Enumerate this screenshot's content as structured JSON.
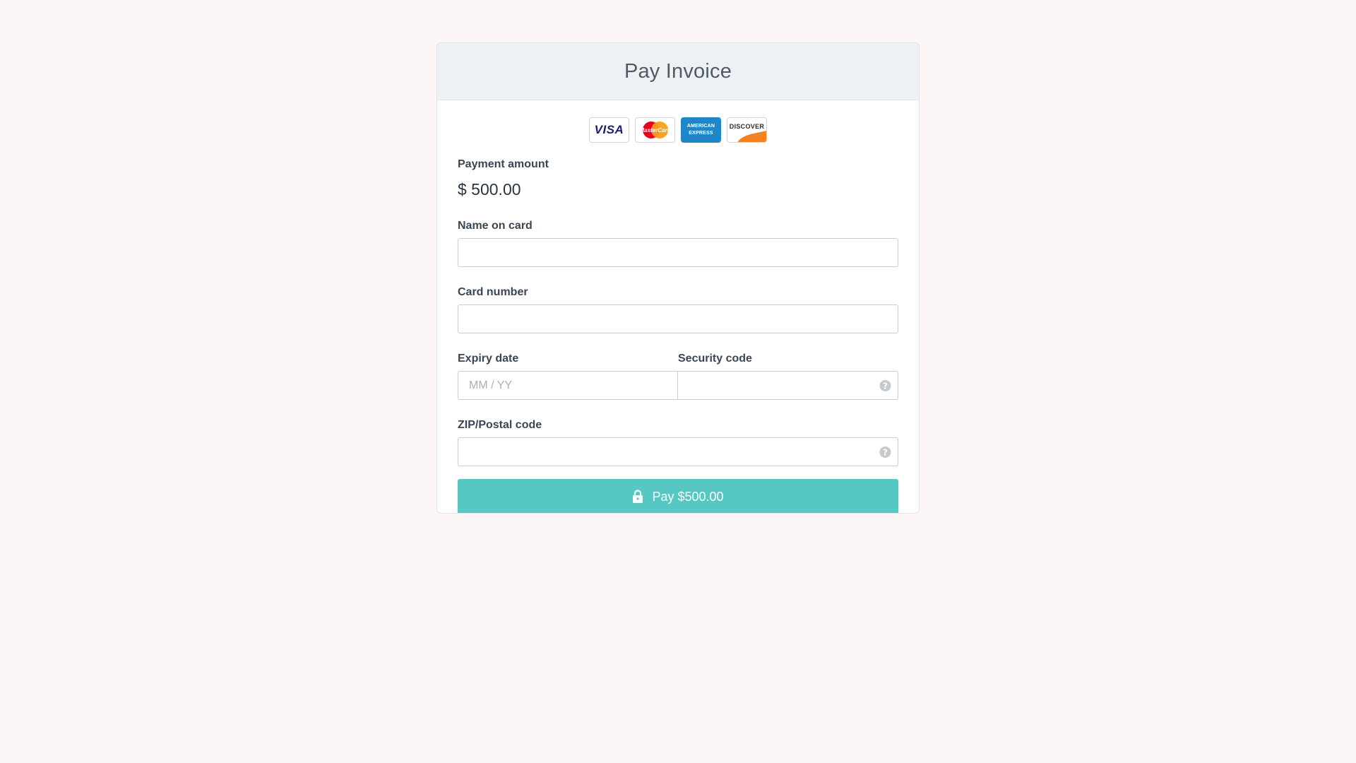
{
  "header": {
    "title": "Pay Invoice"
  },
  "card_brands": [
    {
      "name": "visa",
      "label": "VISA",
      "icon": "visa-logo"
    },
    {
      "name": "mastercard",
      "label": "MasterCard",
      "icon": "mastercard-logo"
    },
    {
      "name": "amex",
      "label_line1": "AMERICAN",
      "label_line2": "EXPRESS",
      "icon": "amex-logo"
    },
    {
      "name": "discover",
      "label": "DISCOVER",
      "icon": "discover-logo"
    }
  ],
  "payment": {
    "amount_label": "Payment amount",
    "amount_value": "$ 500.00"
  },
  "form": {
    "name_label": "Name on card",
    "name_value": "",
    "card_number_label": "Card number",
    "card_number_value": "",
    "expiry_label": "Expiry date",
    "expiry_placeholder": "MM / YY",
    "security_label": "Security code",
    "security_value": "",
    "zip_label": "ZIP/Postal code",
    "zip_value": ""
  },
  "pay_button": {
    "label": "Pay $500.00",
    "icon": "lock-icon"
  },
  "colors": {
    "background": "#fcf7f6",
    "header_bg": "#eef1f4",
    "accent": "#56c8c3",
    "amex_blue": "#1f86c7",
    "discover_orange": "#f58220"
  }
}
